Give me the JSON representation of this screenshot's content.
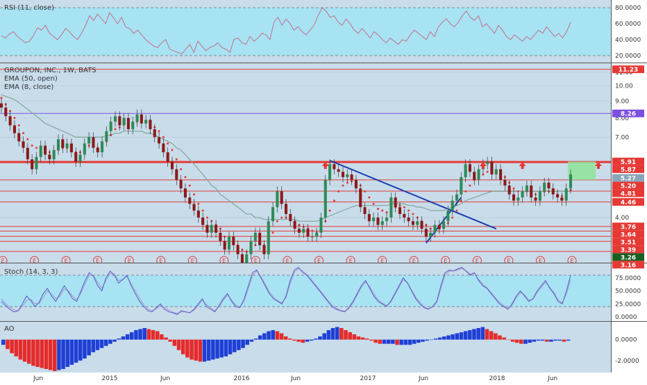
{
  "chart_data": [
    {
      "type": "line",
      "panel": "rsi",
      "title": "RSI (11, close)",
      "ylim": [
        13,
        88
      ],
      "bands": [
        80,
        20
      ],
      "ticks": [
        "80.0000",
        "60.0000",
        "40.0000",
        "20.0000"
      ],
      "tick_values": [
        80,
        60,
        40,
        20
      ],
      "series": [
        {
          "values": [
            45,
            42,
            47,
            50,
            44,
            40,
            36,
            38,
            45,
            55,
            52,
            58,
            48,
            44,
            40,
            46,
            54,
            50,
            44,
            40,
            48,
            58,
            70,
            64,
            72,
            66,
            60,
            74,
            67,
            60,
            68,
            56,
            54,
            48,
            52,
            46,
            40,
            36,
            32,
            30,
            36,
            40,
            28,
            26,
            24,
            22,
            28,
            34,
            24,
            38,
            32,
            26,
            30,
            32,
            36,
            30,
            28,
            24,
            40,
            42,
            36,
            34,
            44,
            38,
            42,
            48,
            46,
            40,
            62,
            68,
            58,
            66,
            60,
            52,
            56,
            50,
            46,
            52,
            58,
            70,
            80,
            76,
            68,
            70,
            62,
            58,
            66,
            60,
            52,
            48,
            54,
            48,
            42,
            50,
            46,
            40,
            36,
            42,
            38,
            34,
            40,
            38,
            46,
            52,
            48,
            44,
            40,
            50,
            44,
            56,
            62,
            66,
            60,
            56,
            62,
            70,
            76,
            68,
            64,
            70,
            56,
            60,
            54,
            48,
            58,
            52,
            44,
            40,
            46,
            42,
            38,
            44,
            40,
            46,
            52,
            48,
            56,
            50,
            44,
            48,
            42,
            50,
            62
          ]
        }
      ]
    },
    {
      "type": "candlestick",
      "panel": "price",
      "title": "GROUPON, INC., 1W, BATS",
      "indicators": [
        "EMA (50, open)",
        "EMA (8, close)"
      ],
      "ylim": [
        2.95,
        11.6
      ],
      "scale": "log",
      "ticks": [
        "11.00",
        "10.00",
        "9.00",
        "8.00",
        "7.00",
        "5.00",
        "4.00"
      ],
      "tick_values": [
        11,
        10,
        9,
        8,
        7,
        5,
        4
      ],
      "markers": [
        11.23,
        8.26,
        5.91,
        5.87,
        5.27,
        5.2,
        4.81,
        4.46,
        3.76,
        3.64,
        3.51,
        3.39,
        3.26,
        3.16
      ],
      "markers_text": [
        "11.23",
        "8.26",
        "5.91",
        "5.87",
        "5.27",
        "5.20",
        "4.81",
        "4.46",
        "3.76",
        "3.64",
        "3.51",
        "3.39",
        "3.26",
        "3.16"
      ],
      "marker_colors": [
        "#e53935",
        "#7b4fe0",
        "#e53935",
        "#e53935",
        "#8aa4b8",
        "#e53935",
        "#e53935",
        "#e53935",
        "#e53935",
        "#e53935",
        "#e53935",
        "#e53935",
        "#1b5e20",
        "#e53935"
      ],
      "earnings_label": "E",
      "earnings_count": 19,
      "x_labels": [
        "Jun",
        "2015",
        "Jun",
        "2016",
        "Jun",
        "2017",
        "Jun",
        "2018",
        "Jun"
      ],
      "closes": [
        8.6,
        8.1,
        7.6,
        7.2,
        6.8,
        6.5,
        6.0,
        5.6,
        6.1,
        6.6,
        6.2,
        6.0,
        6.4,
        6.9,
        6.5,
        6.7,
        6.3,
        5.9,
        6.2,
        6.7,
        7.0,
        6.5,
        6.3,
        6.8,
        7.3,
        7.8,
        8.1,
        7.6,
        8.0,
        7.4,
        7.8,
        8.2,
        7.7,
        7.9,
        7.4,
        7.0,
        6.7,
        6.3,
        5.9,
        5.6,
        5.2,
        4.9,
        4.6,
        4.4,
        4.2,
        4.0,
        3.8,
        3.6,
        3.8,
        3.6,
        3.4,
        3.2,
        3.5,
        3.3,
        3.1,
        2.9,
        3.1,
        3.4,
        3.6,
        3.3,
        3.1,
        3.9,
        4.3,
        4.8,
        4.4,
        4.1,
        3.9,
        3.7,
        3.6,
        3.7,
        3.5,
        3.5,
        3.6,
        4.0,
        5.2,
        5.8,
        5.6,
        5.5,
        5.3,
        5.4,
        5.2,
        4.9,
        4.3,
        4.1,
        3.9,
        4.0,
        3.8,
        3.9,
        4.0,
        4.6,
        4.3,
        4.1,
        4.0,
        3.9,
        3.8,
        3.9,
        3.7,
        3.5,
        3.6,
        3.8,
        3.7,
        3.9,
        4.2,
        4.5,
        4.7,
        5.3,
        5.8,
        5.5,
        5.2,
        5.6,
        5.8,
        5.9,
        5.4,
        5.6,
        5.2,
        5.0,
        4.7,
        4.5,
        4.6,
        4.8,
        5.0,
        4.6,
        4.5,
        4.8,
        5.1,
        4.9,
        4.7,
        4.6,
        4.5,
        4.9,
        5.4
      ],
      "ema50": [
        9.4,
        9.3,
        9.2,
        9.1,
        8.9,
        8.7,
        8.5,
        8.3,
        8.1,
        7.9,
        7.7,
        7.6,
        7.5,
        7.4,
        7.3,
        7.2,
        7.1,
        7.0,
        7.0,
        7.0,
        7.0,
        7.0,
        7.0,
        7.0,
        7.1,
        7.1,
        7.2,
        7.2,
        7.3,
        7.3,
        7.3,
        7.3,
        7.3,
        7.2,
        7.2,
        7.1,
        7.0,
        6.9,
        6.8,
        6.7,
        6.5,
        6.4,
        6.2,
        6.0,
        5.8,
        5.6,
        5.4,
        5.2,
        5.0,
        4.9,
        4.7,
        4.6,
        4.5,
        4.4,
        4.3,
        4.2,
        4.1,
        4.1,
        4.0,
        4.0,
        3.95,
        3.95,
        3.95,
        3.95,
        3.95,
        3.95,
        3.95,
        3.95,
        3.9,
        3.9,
        3.9,
        3.9,
        3.9,
        3.95,
        4.0,
        4.05,
        4.1,
        4.15,
        4.2,
        4.25,
        4.3,
        4.35,
        4.35,
        4.35,
        4.35,
        4.35,
        4.35,
        4.35,
        4.35,
        4.4,
        4.4,
        4.4,
        4.4,
        4.35,
        4.35,
        4.3,
        4.3,
        4.25,
        4.2,
        4.2,
        4.2,
        4.2,
        4.25,
        4.3,
        4.35,
        4.4,
        4.5,
        4.55,
        4.6,
        4.65,
        4.7,
        4.75,
        4.8,
        4.8,
        4.8,
        4.8,
        4.8,
        4.8,
        4.8,
        4.8,
        4.8,
        4.8,
        4.8,
        4.8,
        4.8,
        4.8,
        4.8,
        4.8,
        4.8,
        4.8,
        4.8
      ],
      "ema8": [
        9.2,
        8.8,
        8.4,
        8.0,
        7.6,
        7.2,
        6.9,
        6.6,
        6.5,
        6.5,
        6.4,
        6.3,
        6.3,
        6.4,
        6.5,
        6.5,
        6.4,
        6.3,
        6.3,
        6.4,
        6.6,
        6.6,
        6.5,
        6.6,
        6.8,
        7.1,
        7.4,
        7.5,
        7.7,
        7.7,
        7.7,
        7.8,
        7.8,
        7.8,
        7.7,
        7.5,
        7.3,
        7.0,
        6.7,
        6.4,
        6.0,
        5.6,
        5.3,
        5.0,
        4.7,
        4.4,
        4.2,
        4.0,
        3.9,
        3.8,
        3.7,
        3.5,
        3.4,
        3.35,
        3.3,
        3.2,
        3.15,
        3.2,
        3.3,
        3.35,
        3.3,
        3.4,
        3.6,
        3.9,
        4.0,
        4.0,
        3.95,
        3.9,
        3.8,
        3.75,
        3.7,
        3.65,
        3.6,
        3.7,
        3.9,
        4.2,
        4.5,
        4.8,
        5.0,
        5.1,
        5.15,
        5.15,
        5.0,
        4.8,
        4.6,
        4.4,
        4.25,
        4.2,
        4.15,
        4.2,
        4.3,
        4.35,
        4.3,
        4.2,
        4.1,
        4.0,
        3.9,
        3.8,
        3.7,
        3.65,
        3.7,
        3.75,
        3.85,
        4.0,
        4.2,
        4.5,
        4.8,
        5.0,
        5.2,
        5.3,
        5.4,
        5.5,
        5.5,
        5.5,
        5.4,
        5.3,
        5.1,
        4.9,
        4.8,
        4.75,
        4.8,
        4.75,
        4.7,
        4.7,
        4.8,
        4.8,
        4.75,
        4.7,
        4.65,
        4.7,
        4.85
      ]
    },
    {
      "type": "line",
      "panel": "stoch",
      "title": "Stoch (14, 3, 3)",
      "ylim": [
        -5,
        100
      ],
      "bands": [
        80,
        20
      ],
      "ticks": [
        "75.0000",
        "50.0000",
        "25.0000",
        "0.0000"
      ],
      "tick_values": [
        75,
        50,
        25,
        0
      ],
      "series": [
        {
          "name": "K",
          "values": [
            30,
            22,
            15,
            10,
            12,
            25,
            40,
            32,
            20,
            28,
            45,
            55,
            40,
            30,
            45,
            60,
            48,
            35,
            30,
            50,
            70,
            85,
            78,
            60,
            50,
            75,
            88,
            80,
            65,
            72,
            80,
            60,
            45,
            30,
            20,
            12,
            10,
            18,
            25,
            15,
            10,
            8,
            5,
            12,
            10,
            8,
            15,
            25,
            35,
            20,
            15,
            10,
            22,
            35,
            45,
            30,
            20,
            18,
            35,
            60,
            85,
            90,
            75,
            60,
            45,
            35,
            30,
            25,
            40,
            70,
            90,
            95,
            85,
            80,
            70,
            60,
            50,
            40,
            30,
            20,
            15,
            12,
            10,
            18,
            30,
            45,
            60,
            70,
            55,
            40,
            30,
            25,
            20,
            30,
            45,
            60,
            75,
            65,
            50,
            35,
            25,
            18,
            15,
            20,
            30,
            60,
            85,
            90,
            88,
            92,
            95,
            88,
            80,
            85,
            70,
            60,
            55,
            45,
            35,
            25,
            20,
            15,
            25,
            40,
            50,
            40,
            30,
            35,
            50,
            60,
            70,
            55,
            45,
            30,
            25,
            50,
            80
          ]
        },
        {
          "name": "D",
          "values": [
            35,
            26,
            18,
            14,
            12,
            20,
            32,
            34,
            26,
            26,
            38,
            50,
            44,
            35,
            40,
            54,
            50,
            40,
            33,
            46,
            64,
            80,
            80,
            66,
            55,
            70,
            84,
            82,
            70,
            72,
            78,
            64,
            50,
            36,
            24,
            15,
            12,
            16,
            22,
            18,
            13,
            9,
            7,
            10,
            10,
            9,
            13,
            22,
            32,
            24,
            17,
            12,
            20,
            32,
            42,
            33,
            23,
            19,
            30,
            54,
            80,
            88,
            78,
            63,
            48,
            38,
            32,
            27,
            37,
            64,
            86,
            93,
            88,
            81,
            72,
            62,
            52,
            42,
            32,
            23,
            17,
            13,
            11,
            16,
            27,
            42,
            57,
            67,
            58,
            44,
            33,
            27,
            22,
            28,
            42,
            57,
            71,
            66,
            52,
            38,
            28,
            20,
            16,
            19,
            28,
            55,
            80,
            88,
            88,
            90,
            93,
            89,
            82,
            84,
            72,
            63,
            56,
            47,
            37,
            28,
            22,
            17,
            23,
            37,
            47,
            42,
            33,
            34,
            47,
            57,
            67,
            57,
            47,
            33,
            27,
            45,
            72
          ]
        }
      ]
    },
    {
      "type": "bar",
      "panel": "ao",
      "title": "AO",
      "ylim": [
        -3.0,
        1.5
      ],
      "ticks": [
        "0.0000",
        "-2.0000"
      ],
      "tick_values": [
        0,
        -2
      ],
      "values": [
        -0.5,
        -0.9,
        -1.3,
        -1.6,
        -1.9,
        -2.1,
        -2.3,
        -2.5,
        -2.6,
        -2.7,
        -2.8,
        -2.9,
        -3.0,
        -2.9,
        -2.8,
        -2.6,
        -2.4,
        -2.2,
        -2.0,
        -1.8,
        -1.5,
        -1.2,
        -1.0,
        -0.8,
        -0.6,
        -0.4,
        -0.2,
        0.1,
        0.3,
        0.5,
        0.7,
        0.9,
        1.0,
        1.1,
        1.0,
        0.9,
        0.8,
        0.5,
        0.2,
        -0.2,
        -0.6,
        -1.0,
        -1.4,
        -1.7,
        -1.9,
        -2.0,
        -2.1,
        -2.1,
        -2.0,
        -1.9,
        -1.8,
        -1.7,
        -1.6,
        -1.4,
        -1.2,
        -1.0,
        -0.8,
        -0.5,
        -0.2,
        0.1,
        0.4,
        0.6,
        0.8,
        0.9,
        0.8,
        0.6,
        0.3,
        0.1,
        -0.1,
        -0.2,
        -0.3,
        -0.2,
        -0.1,
        0.1,
        0.3,
        0.6,
        0.9,
        1.1,
        1.2,
        1.1,
        0.9,
        0.7,
        0.5,
        0.3,
        0.2,
        0.1,
        -0.1,
        -0.3,
        -0.4,
        -0.4,
        -0.4,
        -0.4,
        -0.5,
        -0.5,
        -0.5,
        -0.5,
        -0.4,
        -0.3,
        -0.2,
        -0.1,
        0.0,
        0.1,
        0.2,
        0.3,
        0.4,
        0.5,
        0.6,
        0.7,
        0.8,
        0.9,
        1.0,
        1.1,
        1.2,
        1.0,
        0.8,
        0.6,
        0.4,
        0.2,
        0.0,
        -0.2,
        -0.3,
        -0.4,
        -0.4,
        -0.3,
        -0.2,
        -0.1,
        -0.1,
        -0.2,
        -0.2,
        -0.1,
        -0.1,
        -0.2,
        -0.1
      ]
    }
  ]
}
